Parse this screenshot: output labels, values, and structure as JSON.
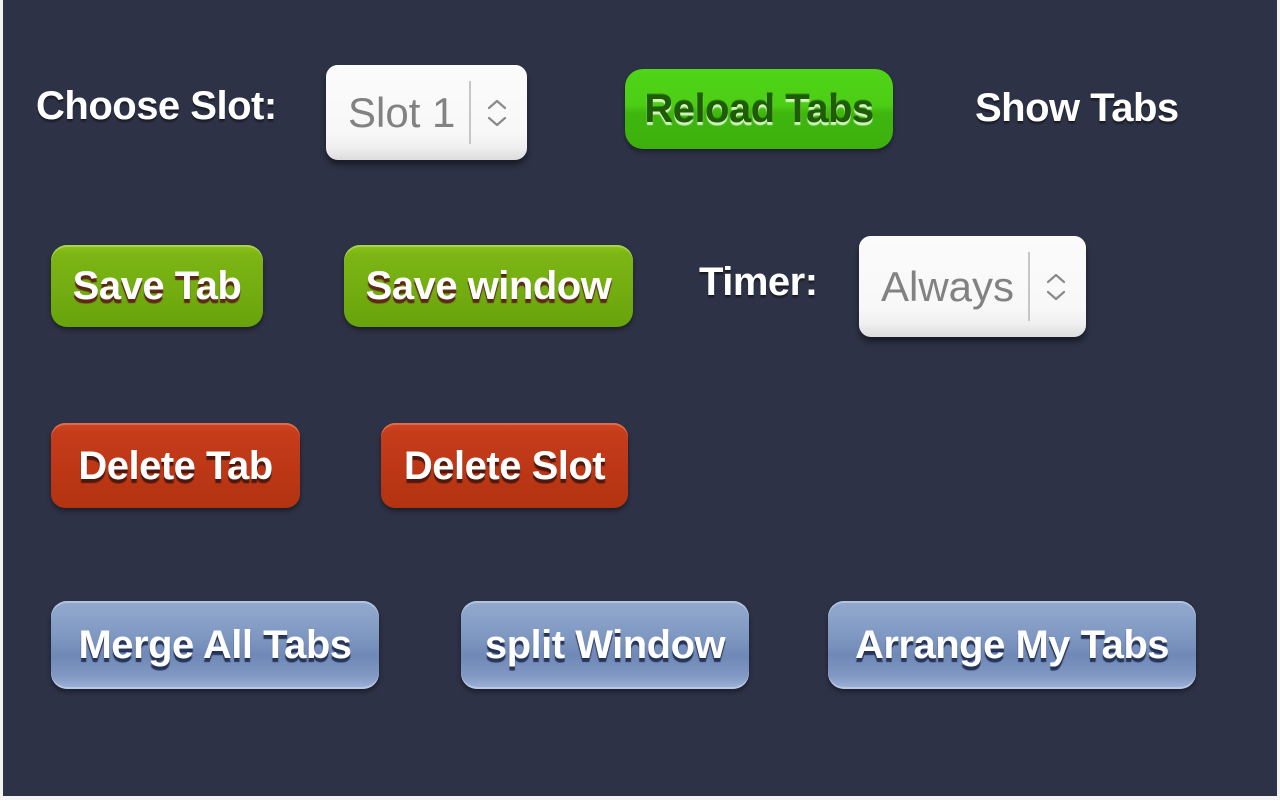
{
  "popup": {
    "background_color": "#2d3246",
    "rows": [
      {
        "name": "slot-row",
        "items": [
          "choose_slot_label",
          "slot_select",
          "reload_tabs",
          "show_tabs"
        ]
      },
      {
        "name": "save-row",
        "items": [
          "save_tab",
          "save_window",
          "timer_label",
          "timer_select"
        ]
      },
      {
        "name": "delete-row",
        "items": [
          "delete_tab",
          "delete_slot"
        ]
      },
      {
        "name": "window-row",
        "items": [
          "merge_all_tabs",
          "split_window",
          "arrange_my_tabs"
        ]
      }
    ]
  },
  "labels": {
    "choose_slot": "Choose Slot:",
    "show_tabs": "Show Tabs",
    "timer": "Timer:"
  },
  "slot_select": {
    "name": "slot-select",
    "value": "Slot 1",
    "placeholder": "Slot 1",
    "options": [
      "Slot 1"
    ],
    "icon_up": "chevron-up-icon",
    "icon_down": "chevron-down-icon",
    "text_color": "#828282",
    "background_color": "#f8f8f8"
  },
  "timer_select": {
    "name": "timer-select",
    "value": "Always",
    "placeholder": "Always",
    "options": [
      "Always"
    ],
    "icon_up": "chevron-up-icon",
    "icon_down": "chevron-down-icon",
    "text_color": "#828282",
    "background_color": "#f8f8f8"
  },
  "buttons": {
    "reload_tabs": {
      "label": "Reload Tabs",
      "color": "#4cce14",
      "text_color": "#1f5c07",
      "variant": "green-bright"
    },
    "save_tab": {
      "label": "Save Tab",
      "color": "#76b014",
      "text_color": "#ffffff",
      "variant": "green-olive"
    },
    "save_window": {
      "label": "Save window",
      "color": "#76b014",
      "text_color": "#ffffff",
      "variant": "green-olive"
    },
    "delete_tab": {
      "label": "Delete Tab",
      "color": "#c03818",
      "text_color": "#ffffff",
      "variant": "red"
    },
    "delete_slot": {
      "label": "Delete Slot",
      "color": "#c03818",
      "text_color": "#ffffff",
      "variant": "red"
    },
    "merge_all_tabs": {
      "label": "Merge All Tabs",
      "color": "#7e97c1",
      "text_color": "#ffffff",
      "variant": "blue"
    },
    "split_window": {
      "label": "split Window",
      "color": "#7e97c1",
      "text_color": "#ffffff",
      "variant": "blue"
    },
    "arrange_my_tabs": {
      "label": "Arrange My Tabs",
      "color": "#7e97c1",
      "text_color": "#ffffff",
      "variant": "blue"
    }
  }
}
